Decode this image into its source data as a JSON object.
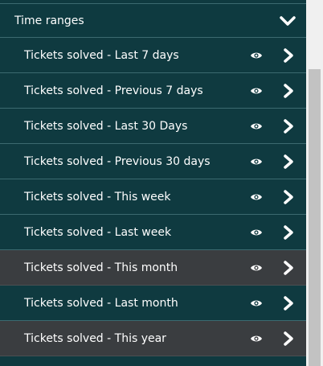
{
  "section": {
    "title": "Time ranges",
    "expanded": true
  },
  "items": [
    {
      "label": "Tickets solved - Last 7 days",
      "active": false
    },
    {
      "label": "Tickets solved - Previous 7 days",
      "active": false
    },
    {
      "label": "Tickets solved - Last 30 Days",
      "active": false
    },
    {
      "label": "Tickets solved - Previous 30 days",
      "active": false
    },
    {
      "label": "Tickets solved - This week",
      "active": false
    },
    {
      "label": "Tickets solved - Last week",
      "active": false
    },
    {
      "label": "Tickets solved - This month",
      "active": true
    },
    {
      "label": "Tickets solved - Last month",
      "active": false
    },
    {
      "label": "Tickets solved - This year",
      "active": true
    }
  ],
  "icons": {
    "collapse": "chevron-down-icon",
    "view": "eye-icon",
    "open": "chevron-right-icon"
  },
  "colors": {
    "panel_bg": "#0f3a40",
    "active_bg": "#3a3d40",
    "divider": "#3c6a70",
    "text": "#ffffff"
  }
}
